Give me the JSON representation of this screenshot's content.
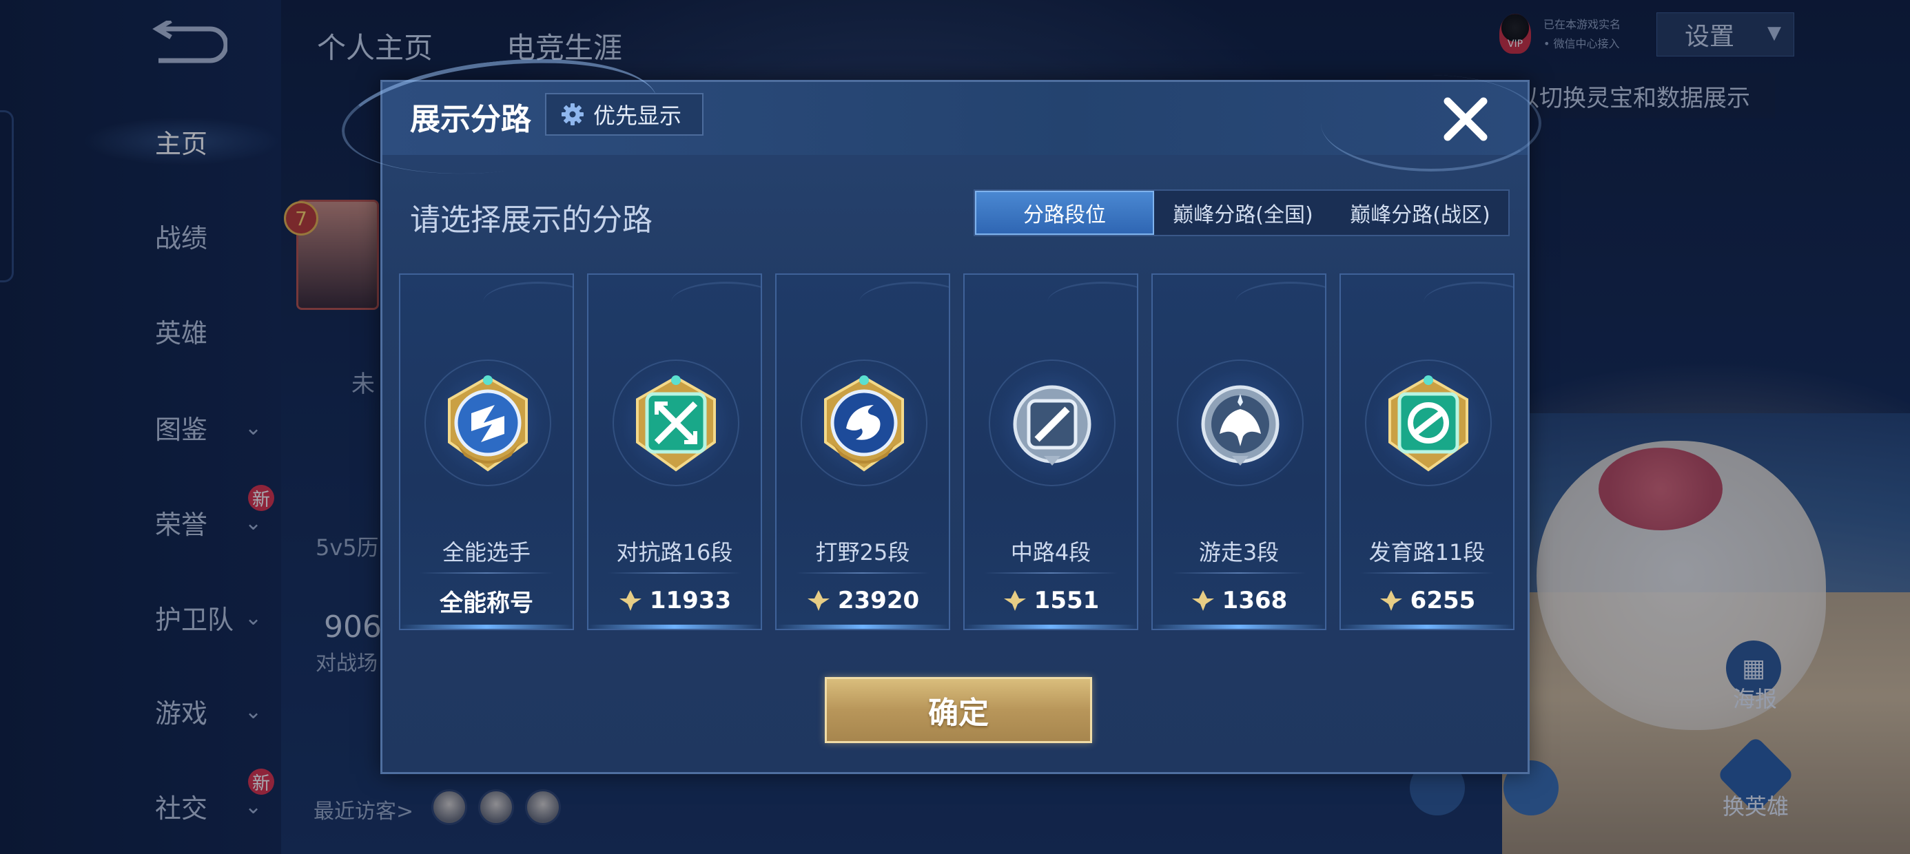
{
  "sidebar": {
    "items": [
      {
        "label": "主页",
        "active": true
      },
      {
        "label": "战绩"
      },
      {
        "label": "英雄"
      },
      {
        "label": "图鉴",
        "has_dropdown": true
      },
      {
        "label": "荣誉",
        "has_dropdown": true,
        "new": "新"
      },
      {
        "label": "护卫队",
        "has_dropdown": true
      },
      {
        "label": "游戏",
        "has_dropdown": true
      },
      {
        "label": "社交",
        "has_dropdown": true,
        "new": "新"
      }
    ]
  },
  "top_tabs": [
    "个人主页",
    "电竞生涯"
  ],
  "vip": {
    "badge": "VIP",
    "line1": "已在本游戏实名",
    "line2": "• 微信中心接入"
  },
  "settings": {
    "label": "设置"
  },
  "hint_text": "以切换灵宝和数据展示",
  "background_text": {
    "level": "7",
    "unranked": "未",
    "history": "5v5历",
    "count": "906",
    "battle_field": "对战场",
    "recent_visitors": "最近访客>",
    "poster": "海报",
    "change_hero": "换英雄"
  },
  "modal": {
    "title": "展示分路",
    "priority_button": "优先显示",
    "subtitle": "请选择展示的分路",
    "tabs": [
      {
        "label": "分路段位",
        "active": true
      },
      {
        "label": "巅峰分路(全国)"
      },
      {
        "label": "巅峰分路(战区)"
      }
    ],
    "cards": [
      {
        "label": "全能选手",
        "value": "全能称号",
        "icon": "all-round-badge",
        "has_score_icon": false
      },
      {
        "label": "对抗路16段",
        "value": "11933",
        "icon": "clash-lane-badge",
        "has_score_icon": true
      },
      {
        "label": "打野25段",
        "value": "23920",
        "icon": "jungle-badge",
        "has_score_icon": true
      },
      {
        "label": "中路4段",
        "value": "1551",
        "icon": "mid-lane-badge",
        "has_score_icon": true
      },
      {
        "label": "游走3段",
        "value": "1368",
        "icon": "roam-badge",
        "has_score_icon": true
      },
      {
        "label": "发育路11段",
        "value": "6255",
        "icon": "farm-lane-badge",
        "has_score_icon": true
      }
    ],
    "confirm_button": "确定"
  }
}
